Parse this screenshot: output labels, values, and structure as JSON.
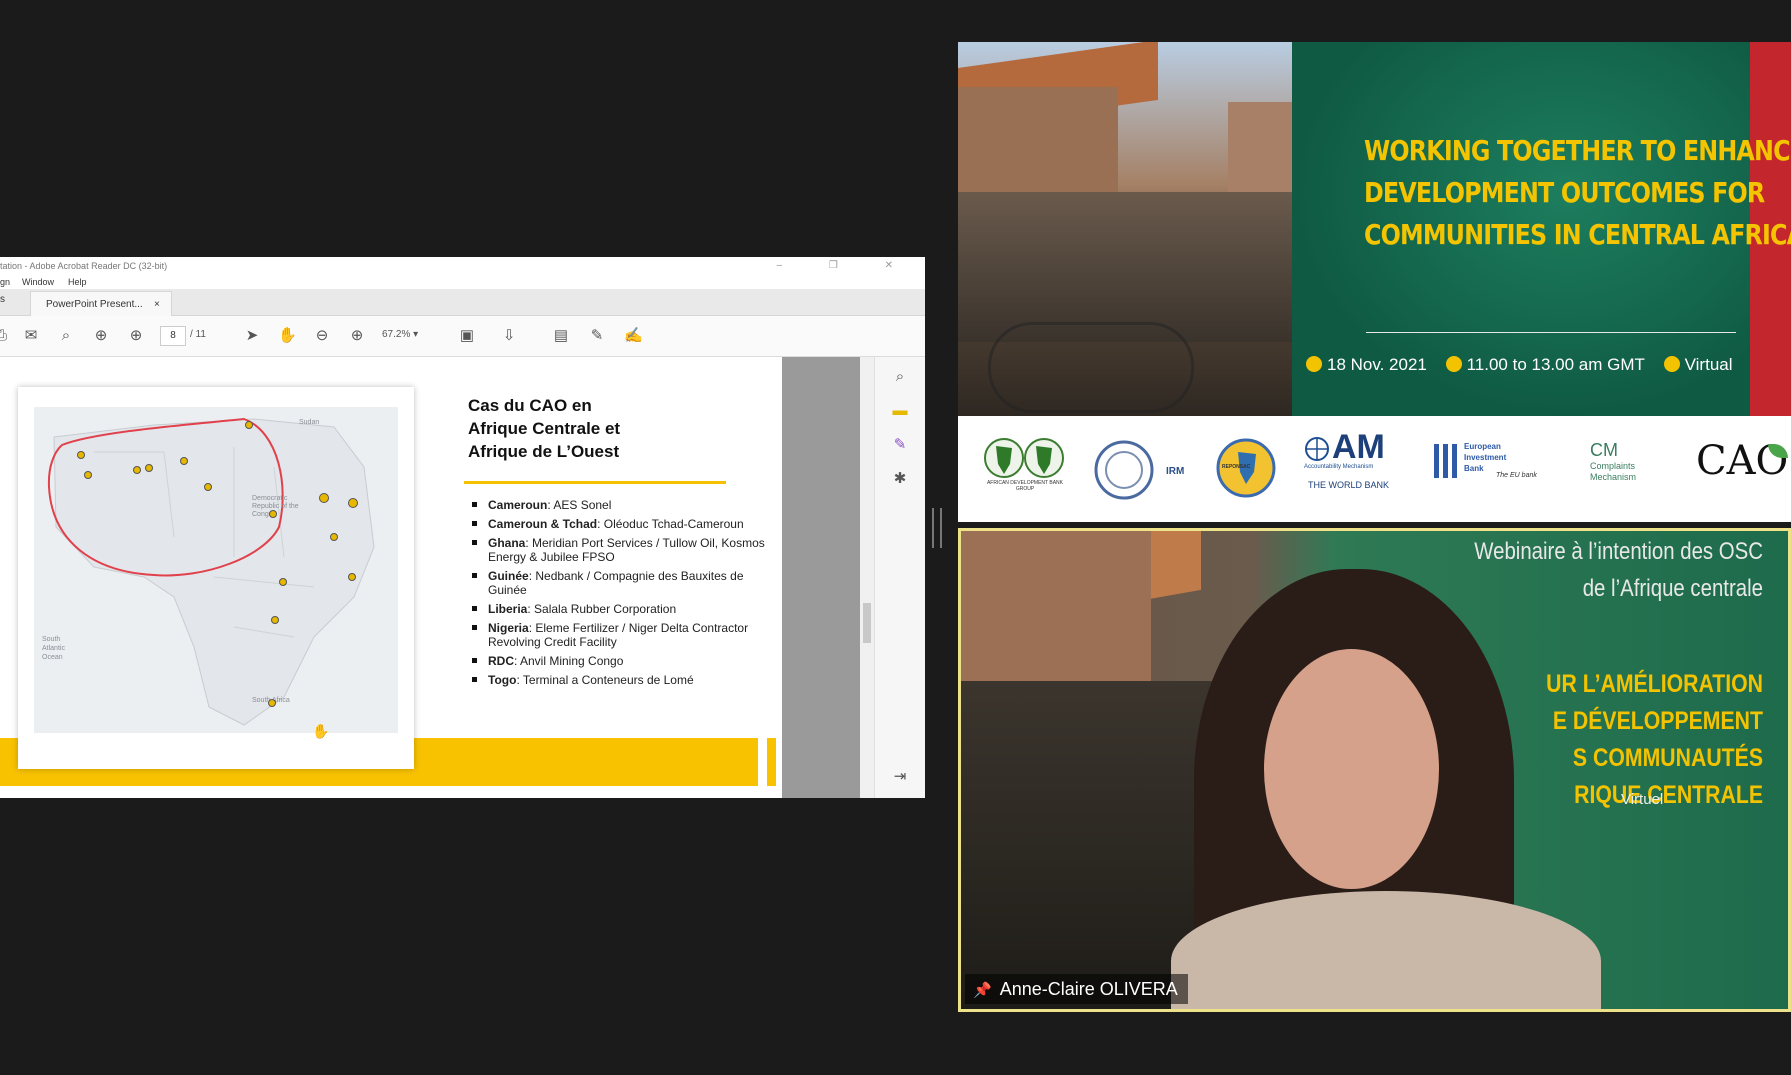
{
  "acrobat": {
    "title": "tation - Adobe Acrobat Reader DC (32-bit)",
    "menu": [
      "gn",
      "Window",
      "Help"
    ],
    "tab_home": "s",
    "tab_doc": "PowerPoint Present...",
    "tab_close": "×",
    "page_current": "8",
    "page_total": "/ 11",
    "zoom": "67.2%"
  },
  "slide": {
    "title_lines": [
      "Cas du CAO en",
      "Afrique Centrale et",
      "Afrique de L’Ouest"
    ],
    "cases": [
      {
        "label": "Cameroun",
        "text": ": AES Sonel"
      },
      {
        "label": "Cameroun & Tchad",
        "text": ": Oléoduc Tchad-Cameroun"
      },
      {
        "label": "Ghana",
        "text": ": Meridian Port Services / Tullow Oil, Kosmos Energy & Jubilee FPSO"
      },
      {
        "label": "Guinée",
        "text": ": Nedbank / Compagnie des Bauxites de Guinée"
      },
      {
        "label": "Liberia",
        "text": ": Salala Rubber Corporation"
      },
      {
        "label": "Nigeria",
        "text": ": Eleme Fertilizer / Niger Delta Contractor Revolving Credit Facility"
      },
      {
        "label": "RDC",
        "text": ": Anvil Mining Congo"
      },
      {
        "label": "Togo",
        "text": ": Terminal a Conteneurs de Lomé"
      }
    ],
    "map_labels": {
      "sudan": "Sudan",
      "drc": "Democratic Republic of the Congo",
      "ocean": "South Atlantic Ocean",
      "south_africa": "South Africa"
    }
  },
  "banner": {
    "title_lines": [
      "WORKING TOGETHER TO ENHANCE",
      "DEVELOPMENT OUTCOMES FOR",
      "COMMUNITIES IN CENTRAL AFRICA"
    ],
    "date": "18 Nov. 2021",
    "time": "11.00 to 13.00 am GMT",
    "mode": "Virtual",
    "accent": "#f5c400"
  },
  "logos": {
    "afdb": "AFRICAN DEVELOPMENT BANK GROUP",
    "irm": "IRM",
    "reponsac": "REPONSAC",
    "am_big": "AM",
    "am_sub": "Accountability Mechanism",
    "world_bank": "THE WORLD BANK",
    "eib_1": "European",
    "eib_2": "Investment",
    "eib_3": "Bank",
    "eib_tag": "The EU bank",
    "cm_big": "CM",
    "cm_1": "Complaints",
    "cm_2": "Mechanism",
    "cao": "CAO"
  },
  "webcam": {
    "bg_text_lines": [
      "Webinaire à l’intention des OSC",
      "de l’Afrique centrale"
    ],
    "bg_text2_lines": [
      "UR L’AMÉLIORATION",
      "E DÉVELOPPEMENT",
      "S COMMUNAUTÉS",
      "RIQUE CENTRALE"
    ],
    "virtuel": "Virtuel",
    "participant_name": "Anne-Claire OLIVERA"
  }
}
